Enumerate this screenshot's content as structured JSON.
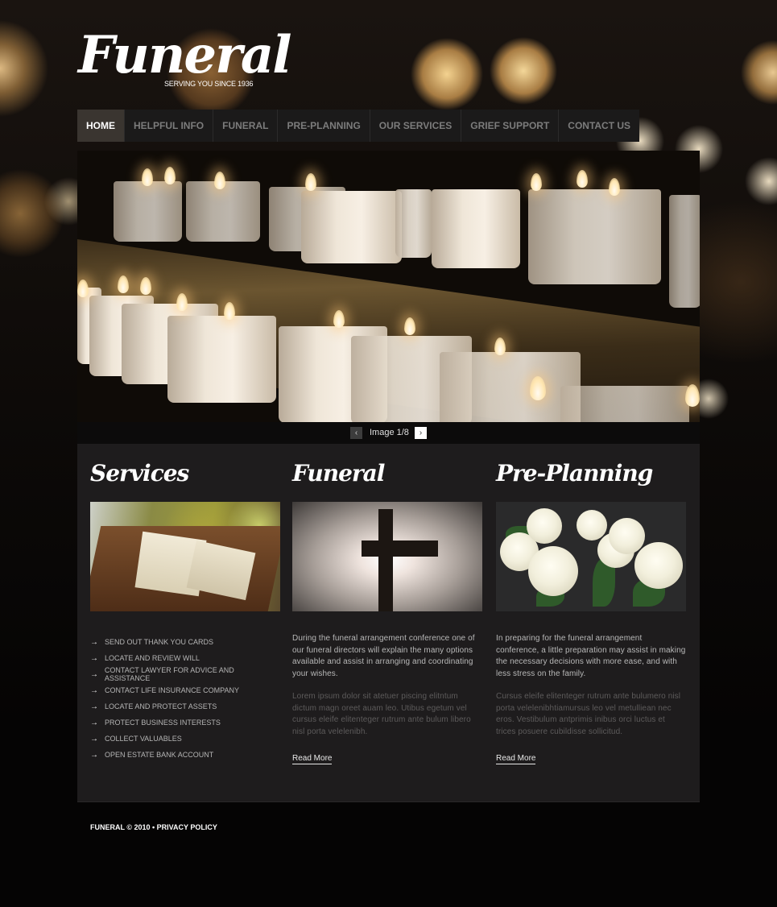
{
  "brand": {
    "title": "Funeral",
    "tagline": "SERVING YOU SINCE 1936"
  },
  "nav": {
    "items": [
      {
        "label": "HOME",
        "active": true
      },
      {
        "label": "HELPFUL INFO",
        "active": false
      },
      {
        "label": "FUNERAL",
        "active": false
      },
      {
        "label": "PRE-PLANNING",
        "active": false
      },
      {
        "label": "OUR SERVICES",
        "active": false
      },
      {
        "label": "GRIEF SUPPORT",
        "active": false
      },
      {
        "label": "CONTACT US",
        "active": false
      }
    ]
  },
  "slider": {
    "image_alt": "lit candles on church shelves",
    "counter": "Image 1/8",
    "current": 1,
    "total": 8,
    "prev_icon": "‹",
    "next_icon": "›"
  },
  "columns": {
    "services": {
      "title": "Services",
      "image_alt": "open bible on lectern",
      "arrow_icon": "→",
      "items": [
        "SEND OUT THANK YOU CARDS",
        "LOCATE AND REVIEW WILL",
        "CONTACT LAWYER FOR ADVICE AND ASSISTANCE",
        "CONTACT LIFE INSURANCE COMPANY",
        "LOCATE AND PROTECT ASSETS",
        "PROTECT BUSINESS INTERESTS",
        "COLLECT VALUABLES",
        "OPEN ESTATE BANK ACCOUNT"
      ]
    },
    "funeral": {
      "title": "Funeral",
      "image_alt": "cross silhouette against light",
      "text": "During the funeral arrangement conference one of our funeral directors will explain the many options available and assist in arranging and coordinating your wishes.",
      "lorem": "Lorem ipsum dolor sit atetuer piscing elitntum dictum magn oreet auam leo. Utibus egetum vel cursus eleife elitenteger rutrum ante bulum libero nisl porta velelenibh.",
      "read_more": "Read More"
    },
    "preplanning": {
      "title": "Pre-Planning",
      "image_alt": "bouquet of white roses",
      "text": "In preparing for the funeral arrangement conference, a little preparation may assist in making the necessary decisions with more ease, and with less stress on the family.",
      "lorem": "Cursus eleife elitenteger rutrum ante bulumero nisl porta velelenibhtiamursus leo vel metulliean nec eros. Vestibulum antprimis inibus orci luctus et trices posuere cubildisse sollicitud.",
      "read_more": "Read More"
    }
  },
  "footer": {
    "copyright": "FUNERAL © 2010 • ",
    "privacy": "PRIVACY POLICY"
  },
  "colors": {
    "page_bg": "#050404",
    "content_bg": "#1e1c1d",
    "nav_bg": "#1b1a1a",
    "nav_active_bg": "#3a3530",
    "nav_text": "#7c7c7c",
    "text_light": "#b8b8b8",
    "text_dim": "#5d5b5b"
  }
}
